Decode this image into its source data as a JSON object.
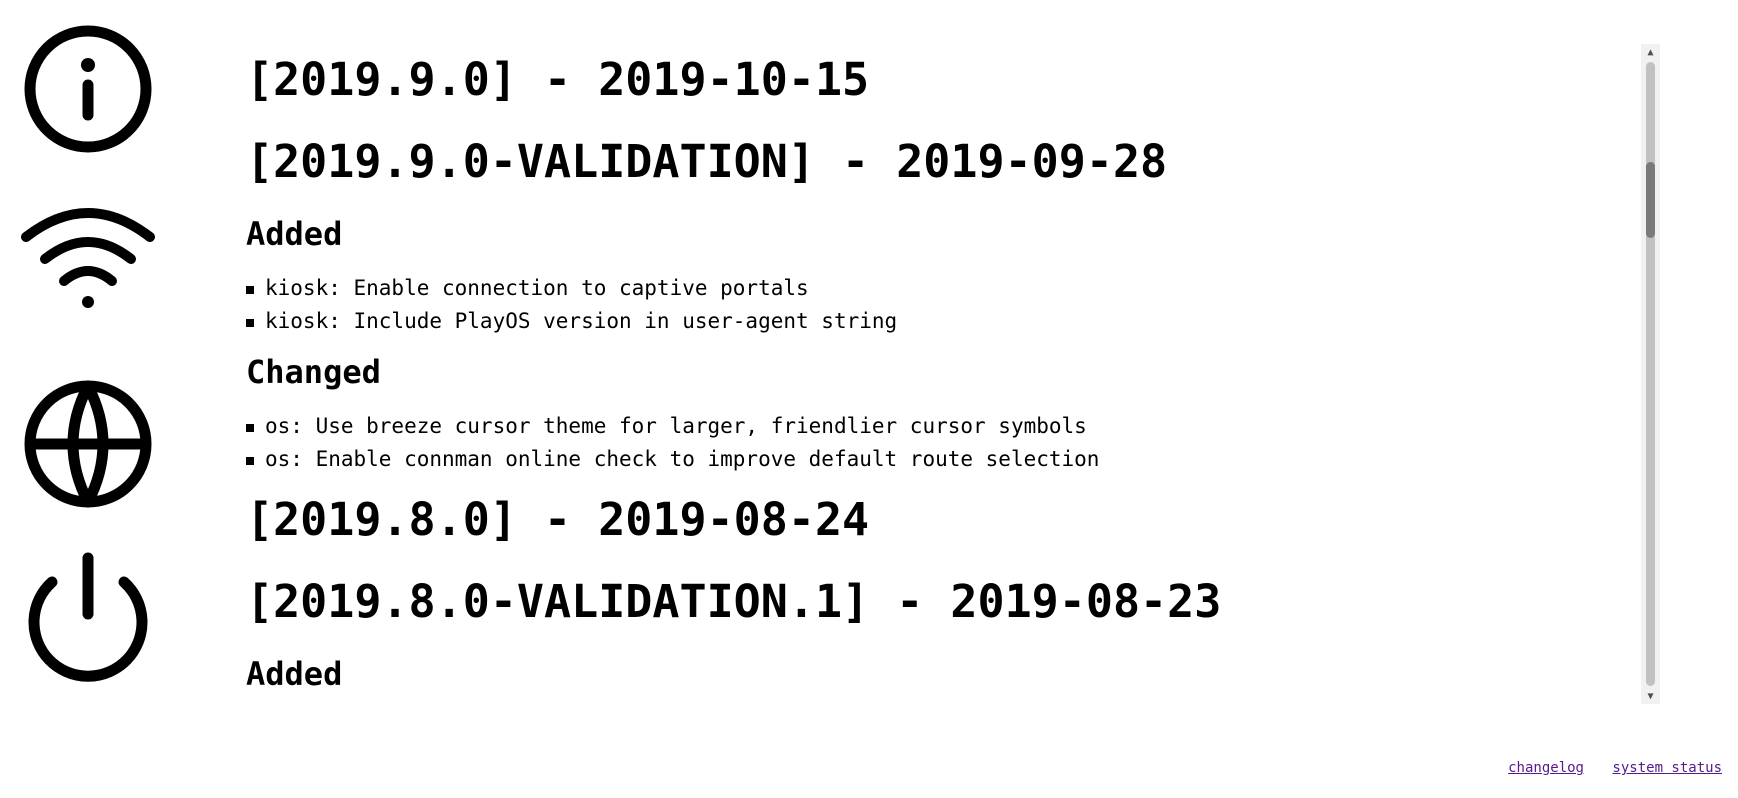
{
  "sidebar": {
    "items": [
      {
        "icon": "info-icon"
      },
      {
        "icon": "wifi-icon"
      },
      {
        "icon": "globe-icon"
      },
      {
        "icon": "power-icon"
      }
    ]
  },
  "changelog": {
    "releases": [
      {
        "heading": "[2019.9.0] - 2019-10-15"
      },
      {
        "heading": "[2019.9.0-VALIDATION] - 2019-09-28",
        "sections": [
          {
            "title": "Added",
            "items": [
              "kiosk: Enable connection to captive portals",
              "kiosk: Include PlayOS version in user-agent string"
            ]
          },
          {
            "title": "Changed",
            "items": [
              "os: Use breeze cursor theme for larger, friendlier cursor symbols",
              "os: Enable connman online check to improve default route selection"
            ]
          }
        ]
      },
      {
        "heading": "[2019.8.0] - 2019-08-24"
      },
      {
        "heading": "[2019.8.0-VALIDATION.1] - 2019-08-23",
        "sections": [
          {
            "title": "Added"
          }
        ]
      }
    ]
  },
  "scrollbar": {
    "up_glyph": "▲",
    "down_glyph": "▼",
    "position_fraction": 0.16
  },
  "footer": {
    "links": [
      "changelog",
      "system status"
    ],
    "link_color": "#551a8b"
  }
}
